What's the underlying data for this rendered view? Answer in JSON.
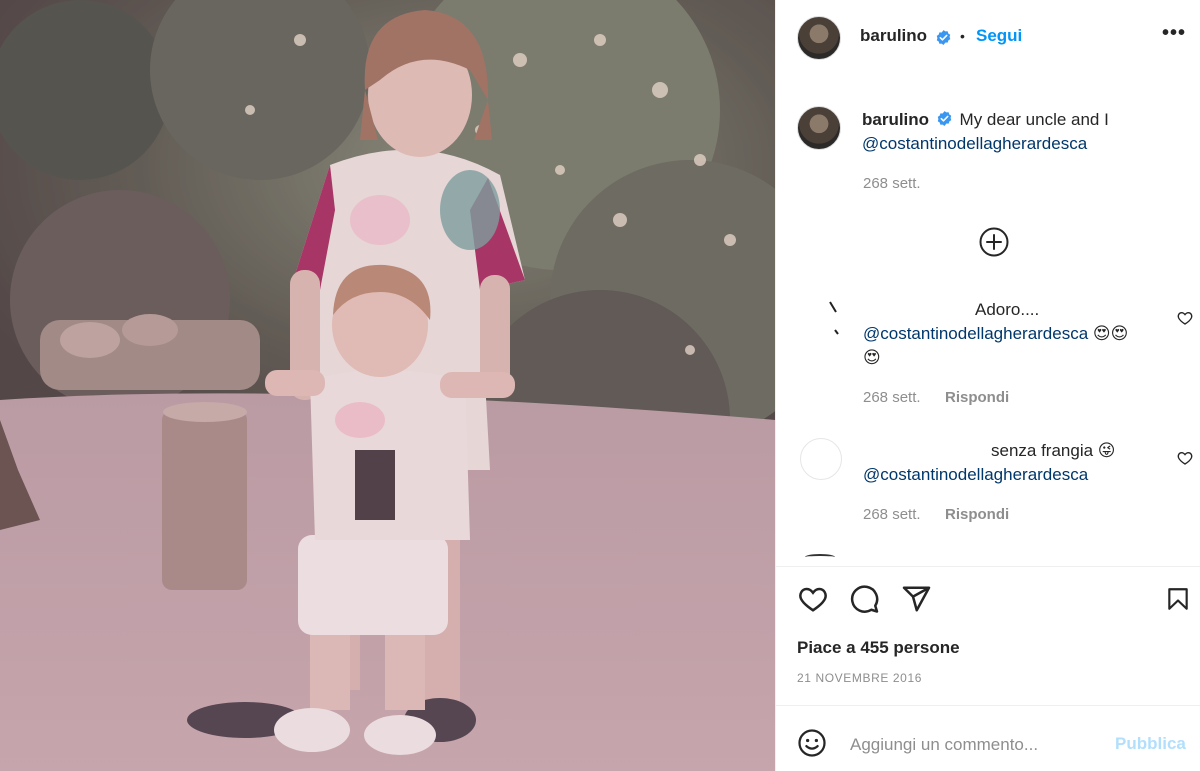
{
  "post": {
    "username": "barulino",
    "follow_label": "Segui",
    "separator": "•",
    "more_label": "•••"
  },
  "caption": {
    "username": "barulino",
    "text": "My dear uncle and I",
    "mention": "@costantinodellagherardesca",
    "time": "268 sett."
  },
  "comments": [
    {
      "text": "Adoro....",
      "mention": "@costantinodellagherardesca",
      "emoji_tail": "😍😍",
      "emoji_line2": "😍",
      "time": "268 sett.",
      "reply_label": "Rispondi"
    },
    {
      "text": "senza frangia 😜",
      "mention": "@costantinodellagherardesca",
      "time": "268 sett.",
      "reply_label": "Rispondi"
    }
  ],
  "actions": {
    "likes_text": "Piace a 455 persone",
    "date_text": "21 NOVEMBRE 2016"
  },
  "add_comment": {
    "placeholder": "Aggiungi un commento...",
    "publish_label": "Pubblica"
  },
  "colors": {
    "link_blue": "#0095f6",
    "mention": "#00376b",
    "muted": "#8e8e8e",
    "publish_disabled": "#b2dffc"
  },
  "icons": [
    "verified-badge-icon",
    "more-options-icon",
    "load-more-comments-icon",
    "heart-icon",
    "comment-icon",
    "share-icon",
    "bookmark-icon",
    "emoji-icon"
  ]
}
